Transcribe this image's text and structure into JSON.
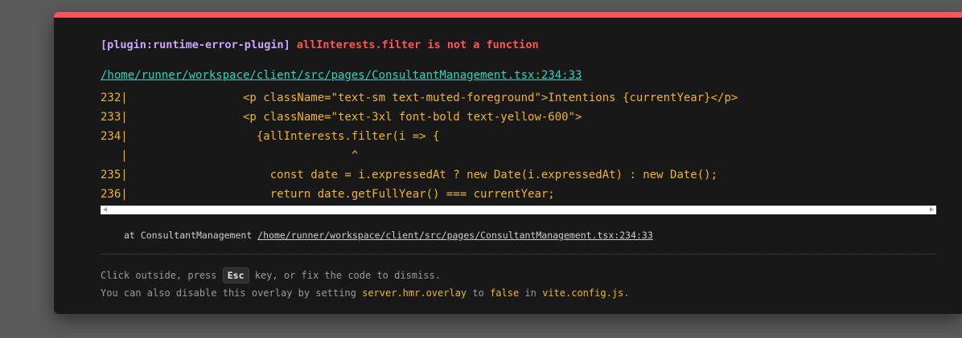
{
  "error": {
    "plugin": "[plugin:runtime-error-plugin]",
    "message": "allInterests.filter is not a function",
    "file": "/home/runner/workspace/client/src/pages/ConsultantManagement.tsx:234:33"
  },
  "code_frame": [
    "232|                 <p className=\"text-sm text-muted-foreground\">Intentions {currentYear}</p>",
    "233|                 <p className=\"text-3xl font-bold text-yellow-600\">",
    "234|                   {allInterests.filter(i => {",
    "   |                                 ^",
    "235|                     const date = i.expressedAt ? new Date(i.expressedAt) : new Date();",
    "236|                     return date.getFullYear() === currentYear;"
  ],
  "stack": {
    "prefix": "at ConsultantManagement ",
    "link": "/home/runner/workspace/client/src/pages/ConsultantManagement.tsx:234:33"
  },
  "tip": {
    "line1_before": "Click outside, press ",
    "key": "Esc",
    "line1_after": " key, or fix the code to dismiss.",
    "line2_a": "You can also disable this overlay by setting ",
    "line2_code1": "server.hmr.overlay",
    "line2_b": " to ",
    "line2_code2": "false",
    "line2_c": " in ",
    "line2_code3": "vite.config.js",
    "line2_d": "."
  },
  "colors": {
    "accent": "#ff5555",
    "plugin": "#cfa5ff",
    "code": "#f0b429",
    "link": "#2dd4bf",
    "background": "#181818"
  }
}
